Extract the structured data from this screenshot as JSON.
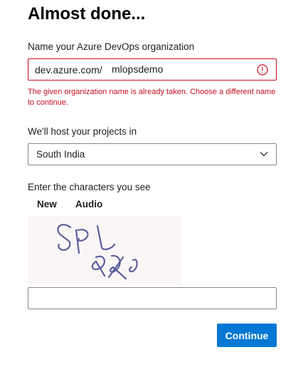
{
  "header": {
    "title": "Almost done..."
  },
  "organization": {
    "label": "Name your Azure DevOps organization",
    "prefix": "dev.azure.com/",
    "value": "mlopsdemo",
    "error_icon": "error-circle-icon",
    "error_message": "The given organization name is already taken. Choose a different name to continue."
  },
  "region": {
    "label": "We'll host your projects in",
    "selected": "South India",
    "icon": "chevron-down-icon"
  },
  "captcha": {
    "label": "Enter the characters you see",
    "new_label": "New",
    "audio_label": "Audio",
    "input_value": ""
  },
  "actions": {
    "continue_label": "Continue"
  },
  "colors": {
    "error": "#c50f1f",
    "accent": "#0078d4",
    "border": "#8a8886"
  }
}
